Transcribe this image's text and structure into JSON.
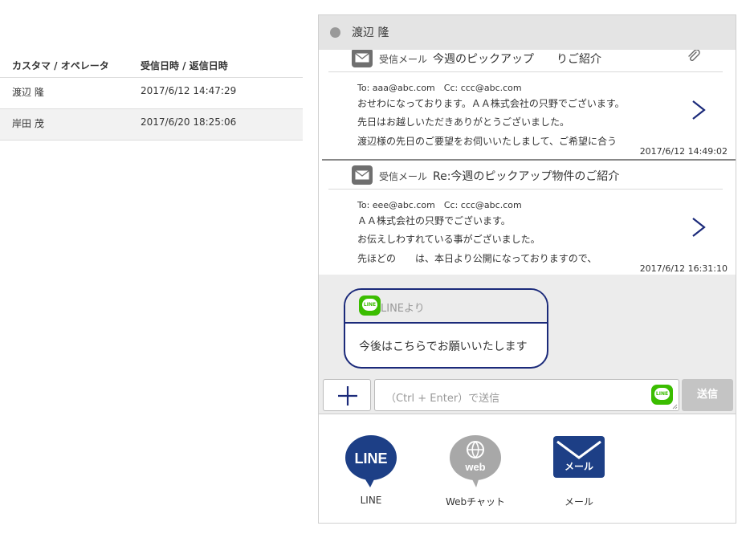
{
  "list": {
    "col_customer": "カスタマ / オペレータ",
    "col_datetime": "受信日時 / 返信日時",
    "rows": [
      {
        "name": "渡辺 隆",
        "datetime": "2017/6/12 14:47:29"
      },
      {
        "name": "岸田 茂",
        "datetime": "2017/6/20 18:25:06"
      }
    ]
  },
  "panel": {
    "customer_name": "渡辺 隆",
    "messages": [
      {
        "type": "受信メール",
        "subject": "今週のピックアップ　　りご紹介",
        "to": "To: aaa@abc.com　Cc:  ccc@abc.com",
        "lines": [
          "おせわになっております。ＡＡ株式会社の只野でございます。",
          "先日はお越しいただきありがとうございました。",
          "渡辺様の先日のご要望をお伺いいたしまして、ご希望に合う"
        ],
        "time": "2017/6/12 14:49:02"
      },
      {
        "type": "受信メール",
        "subject": "Re:今週のピックアップ物件のご紹介",
        "to": "To: eee@abc.com　Cc:  ccc@abc.com",
        "lines": [
          "ＡＡ株式会社の只野でございます。",
          "お伝えしわすれている事がございました。",
          "先ほどの　　は、本日より公開になっておりますので、"
        ],
        "time": "2017/6/12 16:31:10"
      }
    ],
    "bubble": {
      "from": "LINEより",
      "text": "今後はこちらでお願いいたします"
    },
    "input_placeholder": "（Ctrl + Enter）で送信",
    "send_label": "送信",
    "channels": [
      {
        "label": "LINE",
        "icon": "line-icon",
        "icon_text": "LINE"
      },
      {
        "label": "Webチャット",
        "icon": "web-chat-icon",
        "icon_text": "web"
      },
      {
        "label": "メール",
        "icon": "mail-icon",
        "icon_text": "メール"
      }
    ]
  },
  "colors": {
    "navy": "#1b2a7a",
    "line_green": "#3bbd00",
    "send_disabled": "#c4c4c4",
    "line_channel": "#1d3f86",
    "web_channel": "#a8a8a8"
  }
}
